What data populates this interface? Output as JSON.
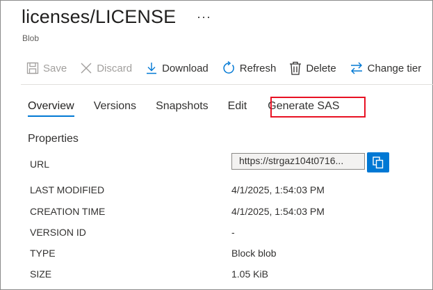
{
  "header": {
    "title": "licenses/LICENSE",
    "subtitle": "Blob",
    "more": "···"
  },
  "toolbar": {
    "save": "Save",
    "discard": "Discard",
    "download": "Download",
    "refresh": "Refresh",
    "delete": "Delete",
    "change_tier": "Change tier"
  },
  "tabs": [
    "Overview",
    "Versions",
    "Snapshots",
    "Edit",
    "Generate SAS"
  ],
  "properties": {
    "heading": "Properties",
    "url_label": "URL",
    "url_value": "https://strgaz104t0716...",
    "rows": [
      {
        "label": "LAST MODIFIED",
        "value": "4/1/2025, 1:54:03 PM"
      },
      {
        "label": "CREATION TIME",
        "value": "4/1/2025, 1:54:03 PM"
      },
      {
        "label": "VERSION ID",
        "value": "-"
      },
      {
        "label": "TYPE",
        "value": "Block blob"
      },
      {
        "label": "SIZE",
        "value": "1.05 KiB"
      }
    ]
  },
  "colors": {
    "accent": "#0078d4",
    "highlight": "#e81123"
  }
}
